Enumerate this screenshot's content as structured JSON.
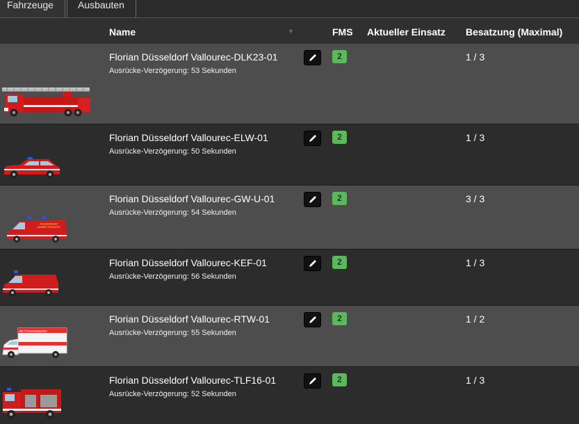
{
  "tabs": [
    {
      "label": "Fahrzeuge"
    },
    {
      "label": "Ausbauten"
    }
  ],
  "table": {
    "headers": {
      "name": "Name",
      "fms": "FMS",
      "current_mission": "Aktueller Einsatz",
      "crew": "Besatzung (Maximal)"
    },
    "rows": [
      {
        "name": "Florian Düsseldorf Vallourec-DLK23-01",
        "delay": "Ausrücke-Verzögerung: 53 Sekunden",
        "fms": "2",
        "mission": "",
        "crew": "1 / 3",
        "vehicle_icon": "turntable-ladder-truck-icon"
      },
      {
        "name": "Florian Düsseldorf Vallourec-ELW-01",
        "delay": "Ausrücke-Verzögerung: 50 Sekunden",
        "fms": "2",
        "mission": "",
        "crew": "1 / 3",
        "vehicle_icon": "command-car-icon"
      },
      {
        "name": "Florian Düsseldorf Vallourec-GW-U-01",
        "delay": "Ausrücke-Verzögerung: 54 Sekunden",
        "fms": "2",
        "mission": "",
        "crew": "3 / 3",
        "vehicle_icon": "environment-van-icon"
      },
      {
        "name": "Florian Düsseldorf Vallourec-KEF-01",
        "delay": "Ausrücke-Verzögerung: 56 Sekunden",
        "fms": "2",
        "mission": "",
        "crew": "1 / 3",
        "vehicle_icon": "small-van-icon"
      },
      {
        "name": "Florian Düsseldorf Vallourec-RTW-01",
        "delay": "Ausrücke-Verzögerung: 55 Sekunden",
        "fms": "2",
        "mission": "",
        "crew": "1 / 2",
        "vehicle_icon": "ambulance-icon"
      },
      {
        "name": "Florian Düsseldorf Vallourec-TLF16-01",
        "delay": "Ausrücke-Verzögerung: 52 Sekunden",
        "fms": "2",
        "mission": "",
        "crew": "1 / 3",
        "vehicle_icon": "tanker-truck-icon"
      }
    ]
  },
  "vehicle_graphics": {
    "ambulance_label": "RETTUNGSDIENST",
    "gwu_label_1": "FEUERWEHR",
    "gwu_label_2": "UMWELTSCHUTZ"
  },
  "colors": {
    "fms_status": "#5cb85c",
    "fire_red": "#d01c1c",
    "row_light": "#4d4d4d",
    "row_dark": "#2c2c2c"
  }
}
